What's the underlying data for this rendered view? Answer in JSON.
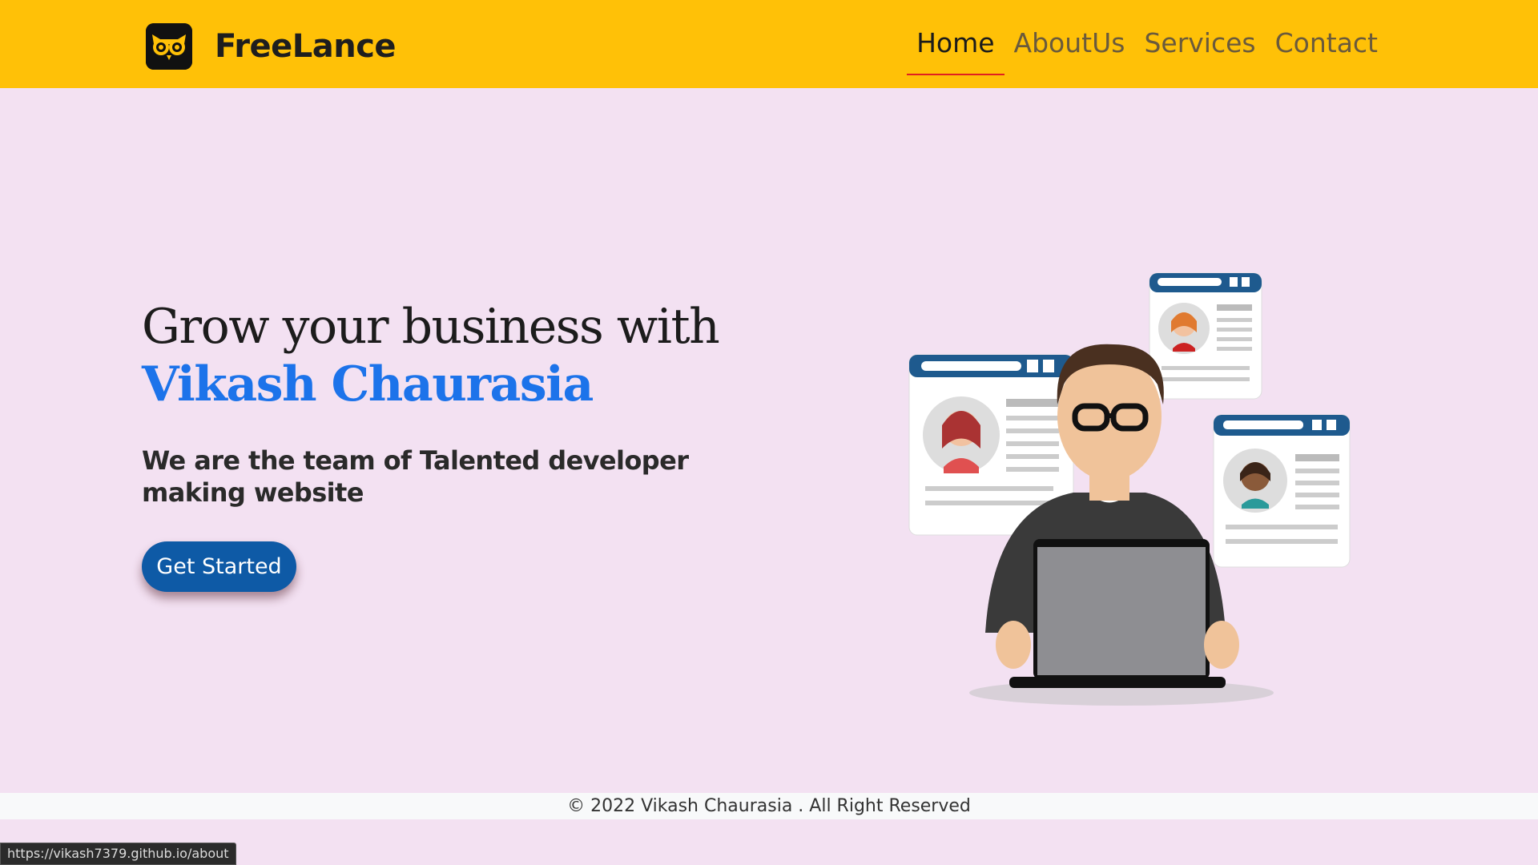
{
  "navbar": {
    "brand": "FreeLance",
    "brand_icon": "owl-logo-icon",
    "links": [
      {
        "label": "Home",
        "active": true
      },
      {
        "label": "AboutUs",
        "active": false
      },
      {
        "label": "Services",
        "active": false
      },
      {
        "label": "Contact",
        "active": false
      }
    ]
  },
  "hero": {
    "title_line1": "Grow your business with",
    "title_name": "Vikash Chaurasia",
    "subtitle": "We are the team of Talented developer making website",
    "cta_label": "Get Started",
    "illustration": "developer-with-laptop-profiles-illustration"
  },
  "footer": {
    "text": "© 2022 Vikash Chaurasia . All Right Reserved"
  },
  "status_bar": {
    "url": "https://vikash7379.github.io/about"
  },
  "colors": {
    "navbar_bg": "#ffc107",
    "page_bg": "#f3e1f2",
    "accent_name": "#1c73ea",
    "button_bg": "#0e5aa6",
    "active_underline": "#e02020"
  }
}
